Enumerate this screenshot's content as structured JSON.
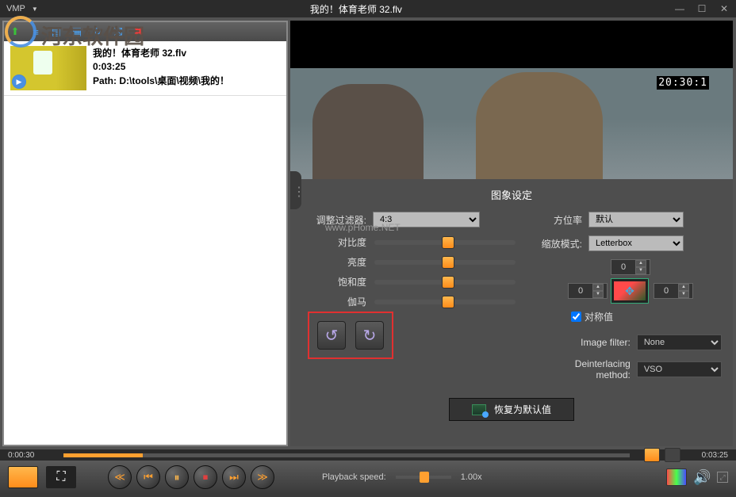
{
  "titlebar": {
    "app": "VMP",
    "title": "我的！体育老师 32.flv"
  },
  "playlist": {
    "item": {
      "name": "我的！体育老师 32.flv",
      "duration": "0:03:25",
      "path": "Path: D:\\tools\\桌面\\视频\\我的！"
    }
  },
  "video": {
    "timestamp_overlay": "20:30:1"
  },
  "settings": {
    "title": "图象设定",
    "filter_label": "调整过滤器:",
    "filter_value": "4:3",
    "aspect_label": "方位率",
    "aspect_value": "默认",
    "zoom_label": "缩放模式:",
    "zoom_value": "Letterbox",
    "contrast_label": "对比度",
    "brightness_label": "亮度",
    "saturation_label": "饱和度",
    "gamma_label": "伽马",
    "crop_top": "0",
    "crop_left": "0",
    "crop_right": "0",
    "symmetric_label": "对称值",
    "image_filter_label": "Image filter:",
    "image_filter_value": "None",
    "deint_label": "Deinterlacing method:",
    "deint_value": "VSO",
    "restore_label": "恢复为默认值"
  },
  "timeline": {
    "current": "0:00:30",
    "total": "0:03:25"
  },
  "playback": {
    "speed_label": "Playback speed:",
    "speed_value": "1.00x"
  },
  "watermark": {
    "site_text": "河东软件园",
    "url_text": "www.pHome.NET"
  }
}
